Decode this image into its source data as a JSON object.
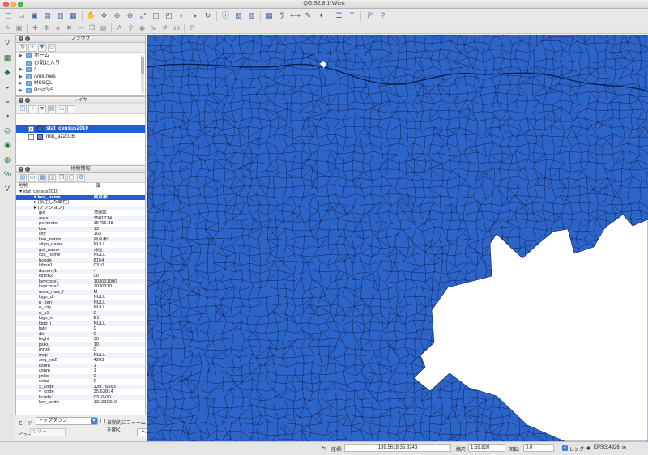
{
  "window": {
    "title": "QGIS2.8.1-Wien"
  },
  "toolbar_main": [
    "new-project-icon",
    "open-project-icon",
    "save-project-icon",
    "save-as-icon",
    "print-composer-icon",
    "composer-manager-icon",
    "pan-icon",
    "pan-to-selection-icon",
    "zoom-in-icon",
    "zoom-out-icon",
    "zoom-full-icon",
    "zoom-layer-icon",
    "zoom-selection-icon",
    "zoom-last-icon",
    "zoom-next-icon",
    "refresh-icon",
    "identify-icon",
    "select-icon",
    "deselect-icon",
    "attribute-table-icon",
    "field-calculator-icon",
    "measure-icon",
    "map-tips-icon",
    "new-bookmark-icon",
    "show-bookmarks-icon",
    "text-annotation-icon",
    "python-console-icon",
    "whats-this-icon"
  ],
  "toolbar_edit": [
    "edit-pencil-icon",
    "save-edits-icon",
    "add-feature-icon",
    "move-feature-icon",
    "node-tool-icon",
    "delete-selected-icon",
    "cut-icon",
    "copy-icon",
    "paste-icon",
    "label-icon",
    "label-pin-icon",
    "label-show-icon",
    "label-move-icon",
    "label-rotate-icon",
    "label-change-icon",
    "python-icon"
  ],
  "browser": {
    "title": "ブラウザ",
    "items": [
      {
        "label": "ホーム",
        "icon": "folder-icon"
      },
      {
        "label": "お気に入り",
        "icon": "star-icon"
      },
      {
        "label": "/",
        "icon": "folder-icon"
      },
      {
        "label": "/Volumes",
        "icon": "folder-icon"
      },
      {
        "label": "MSSQL",
        "icon": "mssql-icon"
      },
      {
        "label": "PostGIS",
        "icon": "postgis-icon"
      }
    ]
  },
  "layers": {
    "title": "レイヤ",
    "items": [
      {
        "label": "stat_census2010",
        "checked": true,
        "selected": true,
        "color": "#3465c7"
      },
      {
        "label": "mlit_az2016",
        "checked": false,
        "selected": false,
        "color": "#8c7ad0"
      }
    ]
  },
  "identify": {
    "title": "地物情報",
    "col_feature": "地物",
    "col_value": "値",
    "root": "stat_census2010",
    "selected_key": "ken_name",
    "selected_value": "東京都",
    "sub_items": [
      "(派生した属性)",
      "(アクション)"
    ],
    "attributes": [
      {
        "k": "gid",
        "v": "75906"
      },
      {
        "k": "area",
        "v": "3581714"
      },
      {
        "k": "perimeter",
        "v": "15766.38"
      },
      {
        "k": "ken",
        "v": "13"
      },
      {
        "k": "city",
        "v": "103"
      },
      {
        "k": "ken_name",
        "v": "東京都"
      },
      {
        "k": "sityo_name",
        "v": "NULL"
      },
      {
        "k": "gst_name",
        "v": "港区"
      },
      {
        "k": "css_name",
        "v": "NULL"
      },
      {
        "k": "hcode",
        "v": "8154"
      },
      {
        "k": "kihon1",
        "v": "0310"
      },
      {
        "k": "dummy1",
        "v": "-"
      },
      {
        "k": "kihon2",
        "v": "00"
      },
      {
        "k": "keycode1",
        "v": "103031000"
      },
      {
        "k": "keycode2",
        "v": "1030310"
      },
      {
        "k": "area_max_f",
        "v": "M"
      },
      {
        "k": "kigo_d",
        "v": "NULL"
      },
      {
        "k": "n_ken",
        "v": "NULL"
      },
      {
        "k": "n_city",
        "v": "NULL"
      },
      {
        "k": "n_c1",
        "v": "0"
      },
      {
        "k": "kigo_e",
        "v": "E1"
      },
      {
        "k": "kigo_i",
        "v": "NULL"
      },
      {
        "k": "tate",
        "v": "0"
      },
      {
        "k": "dir",
        "v": "0"
      },
      {
        "k": "hight",
        "v": "30"
      },
      {
        "k": "jtsiku",
        "v": "10"
      },
      {
        "k": "mnsji",
        "v": "0"
      },
      {
        "k": "moji",
        "v": "NULL"
      },
      {
        "k": "seq_no2",
        "v": "4263"
      },
      {
        "k": "ksum",
        "v": "1"
      },
      {
        "k": "csum",
        "v": "1"
      },
      {
        "k": "jinko",
        "v": "0"
      },
      {
        "k": "setai",
        "v": "0"
      },
      {
        "k": "x_code",
        "v": "139.76563"
      },
      {
        "k": "y_code",
        "v": "35.63814"
      },
      {
        "k": "kcode1",
        "v": "0310-00"
      },
      {
        "k": "key_code",
        "v": "131030310"
      }
    ],
    "mode_label": "モード",
    "mode_value": "トップダウン",
    "auto_open_label": "自動的にフォームを開く",
    "view_label": "ビュー",
    "view_value": "ツリー",
    "help_label": "ヘルプ"
  },
  "map": {
    "fill_color": "#2d64c8",
    "line_color": "#0b1f52",
    "background": "#ffffff"
  },
  "statusbar": {
    "coord_label": "座標:",
    "coord_value": "139.5618,35.8243",
    "scale_label": "縮尺",
    "scale_value": "1:59,820",
    "rotation_label": "回転:",
    "rotation_value": "0.0",
    "render_label": "レンダ",
    "crs_label": "EPSG:4326"
  }
}
